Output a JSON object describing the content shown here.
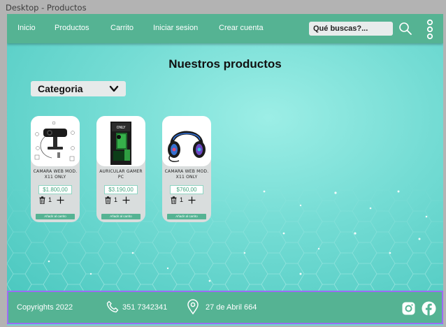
{
  "frame": {
    "title": "Desktop - Productos"
  },
  "nav": {
    "links": [
      "Inicio",
      "Productos",
      "Carrito",
      "Iniciar sesion",
      "Crear cuenta"
    ],
    "search_text": "Qué buscas?...",
    "icons": [
      "search-icon",
      "kebab-menu-icon"
    ]
  },
  "main": {
    "title": "Nuestros productos",
    "category_label": "Categoria"
  },
  "products": [
    {
      "name": "CAMARA WEB MOD. X11 ONLY",
      "price": "$1.800,00",
      "qty": "1",
      "add_label": "Añadir al carrito"
    },
    {
      "name": "AURICULAR GAMER PC",
      "price": "$3.190,00",
      "qty": "1",
      "add_label": "Añadir al carrito"
    },
    {
      "name": "CAMARA WEB MOD. X11 ONLY",
      "price": "$760,00",
      "qty": "1",
      "add_label": "Añadir al carrito"
    }
  ],
  "footer": {
    "copyright": "Copyrights 2022",
    "phone": "351 7342341",
    "address": "27 de Abril 664",
    "icons": [
      "phone-icon",
      "location-pin-icon",
      "instagram-icon",
      "facebook-icon"
    ]
  },
  "colors": {
    "nav": "#55b393",
    "accent": "#44a57f",
    "footer_border": "#9c6cf5"
  }
}
